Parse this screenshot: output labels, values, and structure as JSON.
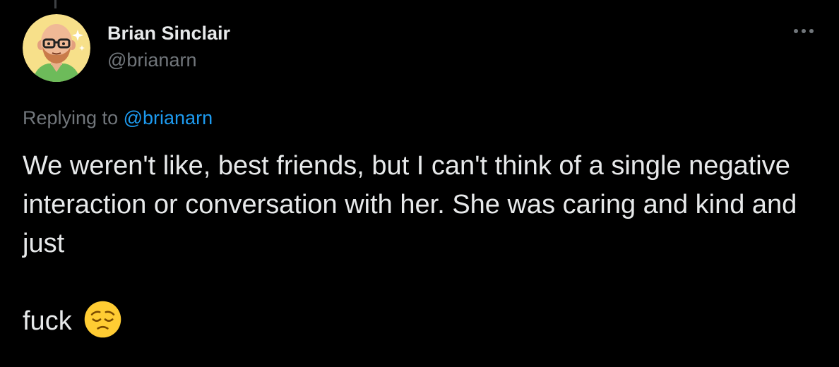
{
  "tweet": {
    "author": {
      "display_name": "Brian Sinclair",
      "handle": "@brianarn",
      "avatar_icon": "cartoon-bald-man-avatar-icon"
    },
    "more_icon": "more-dots-icon",
    "replying_prefix": "Replying to",
    "replying_to": "@brianarn",
    "text_lines": [
      "We weren't like, best friends, but I can't think of a single negative interaction or conversation with her. She was caring and kind and just"
    ],
    "final_word": "fuck",
    "emoji": "pensive-face-emoji",
    "colors": {
      "background": "#000000",
      "text": "#e7e9ea",
      "muted": "#71767b",
      "link": "#1d9bf0"
    }
  }
}
